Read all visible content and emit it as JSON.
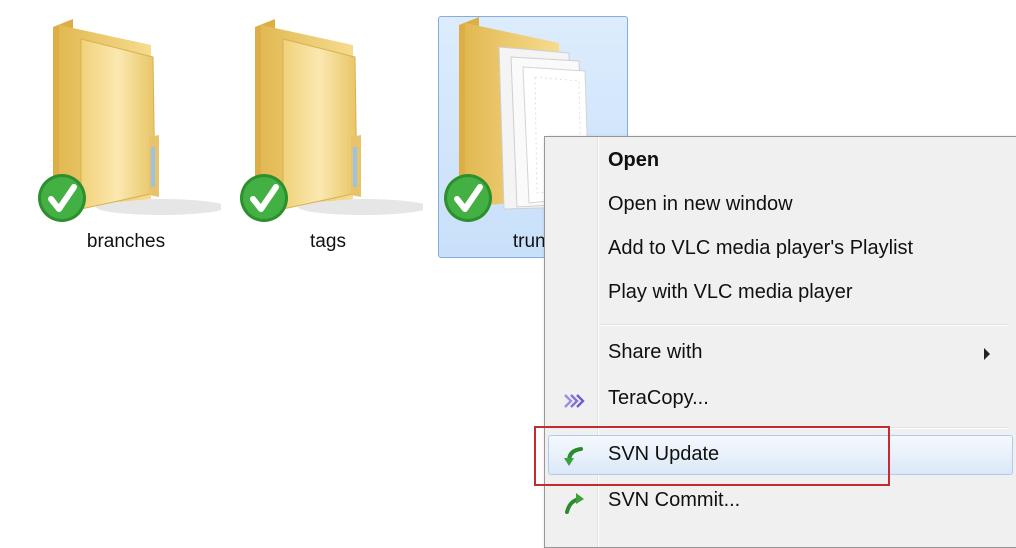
{
  "folders": [
    {
      "label": "branches",
      "icon": "folder-svn-normal-icon",
      "selected": false
    },
    {
      "label": "tags",
      "icon": "folder-svn-normal-icon",
      "selected": false
    },
    {
      "label": "trunk",
      "icon": "folder-documents-svn-normal-icon",
      "selected": true
    }
  ],
  "context_menu": {
    "items": [
      {
        "label": "Open",
        "bold": true
      },
      {
        "label": "Open in new window"
      },
      {
        "label": "Add to VLC media player's Playlist"
      },
      {
        "label": "Play with VLC media player"
      },
      {
        "label": "Share with",
        "submenu": true
      },
      {
        "label": "TeraCopy...",
        "icon": "teracopy-icon"
      },
      {
        "label": "SVN Update",
        "icon": "svn-update-icon",
        "highlighted": true
      },
      {
        "label": "SVN Commit...",
        "icon": "svn-commit-icon"
      }
    ]
  },
  "colors": {
    "selection_fill": "#cce4fa",
    "annotation_red": "#c42a2f",
    "check_green": "#3fa63f",
    "folder_yellow": "#f3d57e"
  }
}
